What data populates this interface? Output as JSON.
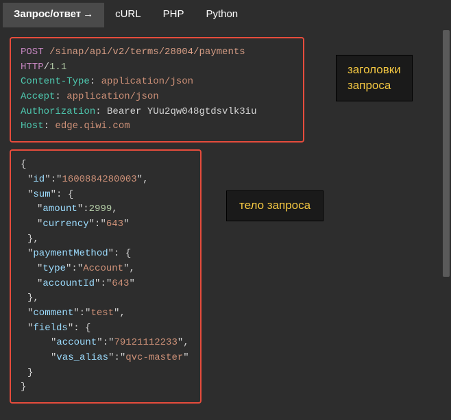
{
  "tabs": {
    "tabs_arrow": "→",
    "items": [
      {
        "label": "Запрос/ответ",
        "active": true
      },
      {
        "label": "cURL",
        "active": false
      },
      {
        "label": "PHP",
        "active": false
      },
      {
        "label": "Python",
        "active": false
      }
    ]
  },
  "annotations": {
    "headers": "заголовки\nзапроса",
    "body": "тело запроса"
  },
  "request": {
    "method": "POST",
    "path": "/sinap/api/v2/terms/28004/payments",
    "protocol": "HTTP",
    "version": "1.1",
    "headers": [
      {
        "name": "Content-Type",
        "value": "application/json"
      },
      {
        "name": "Accept",
        "value": "application/json"
      },
      {
        "name": "Authorization",
        "value": "Bearer YUu2qw048gtdsvlk3iu",
        "bearer": true
      },
      {
        "name": "Host",
        "value": "edge.qiwi.com"
      }
    ]
  },
  "body": {
    "id": "1600884280003",
    "sum": {
      "amount": 2999,
      "currency": "643"
    },
    "paymentMethod": {
      "type": "Account",
      "accountId": "643"
    },
    "comment": "test",
    "fields": {
      "account": "79121112233",
      "vas_alias": "qvc-master"
    }
  }
}
